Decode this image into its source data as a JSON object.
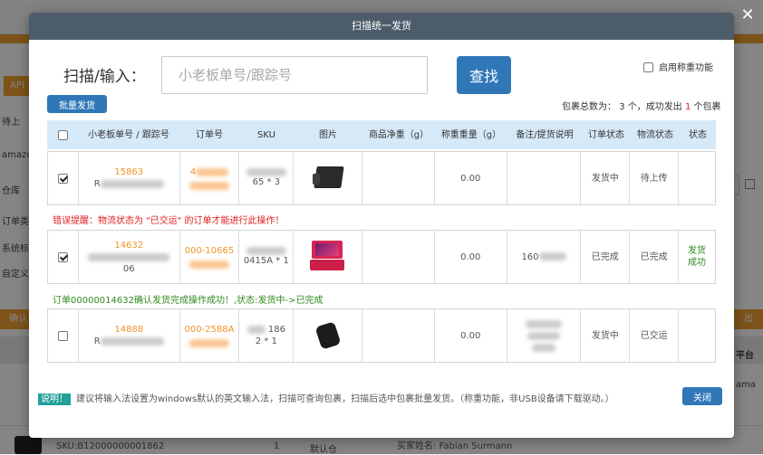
{
  "background": {
    "api_tab": "API",
    "left_items": [
      "待上",
      "amazo",
      "仓库",
      "订单类",
      "系统标",
      "自定义"
    ],
    "confirm_btn": "确认",
    "right_btn": "出",
    "right_items": [
      "平台",
      "ama"
    ],
    "bottom_sku": "SKU:B12000000001862",
    "bottom_qty": "1",
    "bottom_wh": "默认仓",
    "bottom_buyer": "买家姓名: Fabian Surmann"
  },
  "modal": {
    "title": "扫描统一发货",
    "scan_label": "扫描/输入：",
    "scan_placeholder": "小老板单号/跟踪号",
    "find_button": "查找",
    "weigh_label": "启用称重功能",
    "batch_button": "批量发货",
    "summary": {
      "prefix": "包裹总数为：",
      "total": "3",
      "mid": "个，成功发出",
      "success": "1",
      "suffix": "个包裹"
    },
    "columns": [
      "小老板单号 / 跟踪号",
      "订单号",
      "SKU",
      "图片",
      "商品净重（g）",
      "称重重量（g）",
      "备注/提货说明",
      "订单状态",
      "物流状态",
      "状态"
    ],
    "rows": [
      {
        "id": "15863",
        "tracking": "R",
        "order": "4",
        "sku": "65 * 3",
        "gross": "0.00",
        "note": "",
        "order_status": "发货中",
        "logistics_status": "待上传",
        "status": "",
        "checked": true
      },
      {
        "id": "14632",
        "tracking": "06",
        "order": "000-10665",
        "sku": "0415A * 1",
        "gross": "0.00",
        "note": "160",
        "order_status": "已完成",
        "logistics_status": "已完成",
        "status": "发货成功",
        "checked": true
      },
      {
        "id": "14888",
        "tracking": "R",
        "order": "000-2588A",
        "sku": "2 * 1",
        "sku_top": "186",
        "gross": "0.00",
        "note": "",
        "order_status": "发货中",
        "logistics_status": "已交运",
        "status": "",
        "checked": false
      }
    ],
    "error_msg": "错误提醒：物流状态为 \"已交运\" 的订单才能进行此操作！",
    "success_msg": "订单00000014632确认发货完成操作成功！,状态:发货中->已完成",
    "note_tag": "说明！",
    "note_text": "建议将输入法设置为windows默认的英文输入法，扫描可查询包裹，扫描后选中包裹批量发货。（称重功能，非USB设备请下载驱动。）",
    "close_button": "关闭"
  },
  "colors": {
    "header": "#4d5c6a",
    "primary": "#3077b8",
    "table_head": "#d6e9f8",
    "orange": "#f0932a",
    "error": "#e02020",
    "success": "#2f8a1c",
    "tag": "#22a09a"
  }
}
